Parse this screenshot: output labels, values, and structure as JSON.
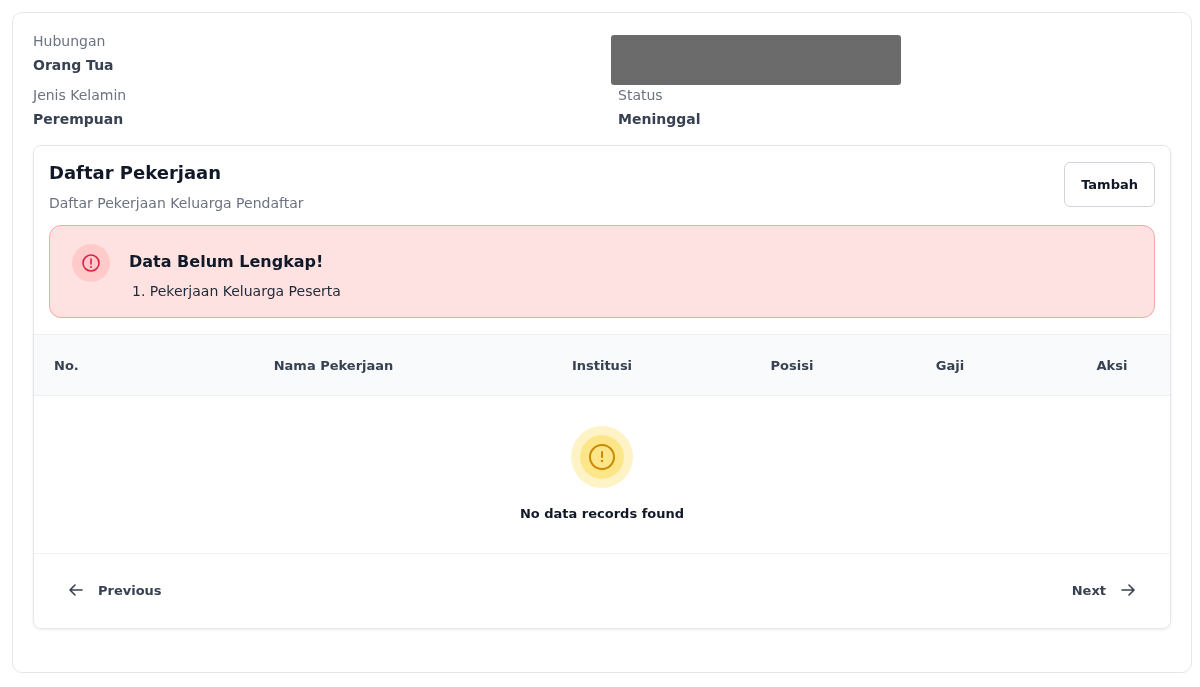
{
  "details": [
    {
      "label": "Hubungan",
      "value": "Orang Tua"
    },
    {
      "label": "Jenis Kelamin",
      "value": "Perempuan"
    },
    {
      "label": "Status",
      "value": "Meninggal"
    }
  ],
  "section": {
    "title": "Daftar Pekerjaan",
    "subtitle": "Daftar Pekerjaan Keluarga Pendaftar",
    "add_button": "Tambah"
  },
  "alert": {
    "title": "Data Belum Lengkap!",
    "items": [
      {
        "marker": "1.",
        "text": "Pekerjaan Keluarga Peserta"
      }
    ]
  },
  "table": {
    "columns": [
      "No.",
      "Nama Pekerjaan",
      "Institusi",
      "Posisi",
      "Gaji",
      "Aksi"
    ],
    "empty_message": "No data records found"
  },
  "pagination": {
    "previous": "Previous",
    "next": "Next"
  }
}
